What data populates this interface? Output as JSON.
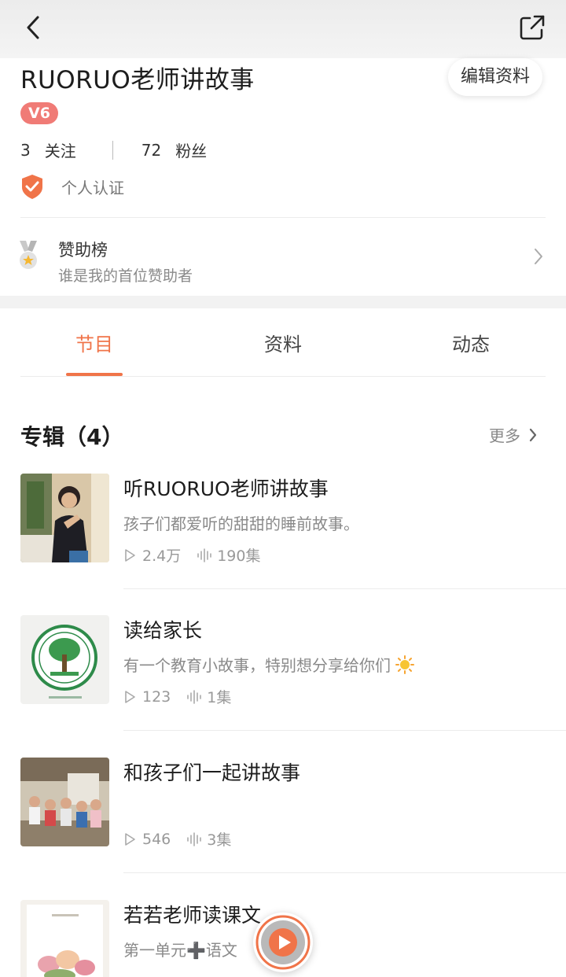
{
  "profile": {
    "name": "RUORUO老师讲故事",
    "edit_label": "编辑资料",
    "level": "V6",
    "following_count": "3",
    "following_label": "关注",
    "fans_count": "72",
    "fans_label": "粉丝",
    "cert_label": "个人认证"
  },
  "sponsor": {
    "title": "赞助榜",
    "subtitle": "谁是我的首位赞助者"
  },
  "tabs": [
    {
      "label": "节目",
      "active": true
    },
    {
      "label": "资料",
      "active": false
    },
    {
      "label": "动态",
      "active": false
    }
  ],
  "albums_section": {
    "title": "专辑（4）",
    "more_label": "更多"
  },
  "albums": [
    {
      "title": "听RUORUO老师讲故事",
      "desc": "孩子们都爱听的甜甜的睡前故事。",
      "plays": "2.4万",
      "episodes": "190集"
    },
    {
      "title": "读给家长",
      "desc": "有一个教育小故事，特别想分享给你们",
      "plays": "123",
      "episodes": "1集"
    },
    {
      "title": "和孩子们一起讲故事",
      "desc": "",
      "plays": "546",
      "episodes": "3集"
    },
    {
      "title": "若若老师读课文",
      "desc": "第一单元➕语文",
      "plays": "",
      "episodes": ""
    }
  ],
  "colors": {
    "accent": "#f07449",
    "badge": "#f07b76",
    "cert": "#f07449"
  }
}
